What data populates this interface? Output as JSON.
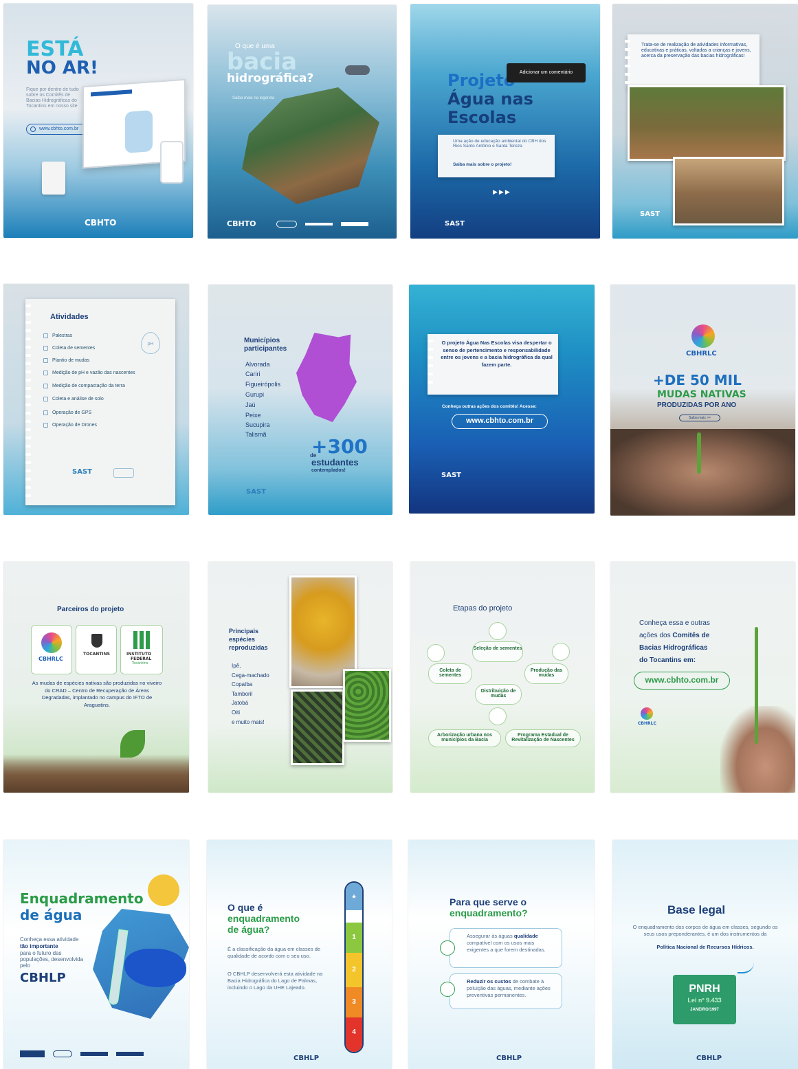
{
  "cards": {
    "c1": {
      "title1": "ESTÁ",
      "title2": "NO AR!",
      "body": "Fique por dentro de tudo sobre os Comitês de Bacias Hidrográficas do Tocantins em nosso site",
      "url": "www.cbhto.com.br",
      "logo": "CBHTO"
    },
    "c2": {
      "q1": "O que é uma",
      "q2": "bacia",
      "q3": "hidrográfica?",
      "sub": "Saiba mais na legenda",
      "logo": "CBHTO"
    },
    "c3": {
      "t1": "Projeto",
      "t2": "Água nas",
      "t3": "Escolas",
      "tooltip": "Adicionar um comentário",
      "b1": "Uma ação de educação ambiental do CBH dos Rios Santo Antônio e Santa Tereza",
      "b2": "Saiba mais sobre o projeto!",
      "arrows": "▶▶▶",
      "logo": "SAST"
    },
    "c4": {
      "note": "Trata-se de realização de atividades informativas, educativas e práticas, voltadas a crianças e jovens, acerca da preservação das bacias hidrográficas!",
      "logo": "SAST"
    },
    "c5": {
      "title": "Atividades",
      "items": [
        "Palestras",
        "Coleta de sementes",
        "Plantio de mudas",
        "Medição de pH e vazão das nascentes",
        "Medição de compactação da terra",
        "Coleta e análise de solo",
        "Operação de GPS",
        "Operação de Drones"
      ],
      "ph": "pH",
      "logo": "SAST"
    },
    "c6": {
      "title1": "Municípios",
      "title2": "participantes",
      "items": [
        "Alvorada",
        "Cariri",
        "Figueirópolis",
        "Gurupi",
        "Jaú",
        "Peixe",
        "Sucupira",
        "Talismã"
      ],
      "de": "de",
      "big": "+300",
      "label1": "estudantes",
      "label2": "contemplados!",
      "logo": "SAST"
    },
    "c7": {
      "text": "O projeto Água Nas Escolas visa despertar o senso de pertencimento e responsabilidade entre os jovens e a bacia hidrográfica da qual fazem parte.",
      "cta": "Conheça outras ações dos comitês! Acesse:",
      "url": "www.cbhto.com.br",
      "logo": "SAST"
    },
    "c8": {
      "logo": "CBHRLC",
      "l1": "+DE 50 MIL",
      "l2": "MUDAS NATIVAS",
      "l3": "PRODUZIDAS POR ANO",
      "more": "Saiba mais >>"
    },
    "c9": {
      "title": "Parceiros do projeto",
      "p1": "CBHRLC",
      "p2": "TOCANTINS",
      "p3a": "INSTITUTO",
      "p3b": "FEDERAL",
      "p3c": "Tocantins",
      "body": "As mudas de espécies nativas são produzidas no viveiro do CRAD – Centro de Recuperação de Áreas Degradadas, implantado no campus do IFTO de Araguatins."
    },
    "c10": {
      "t1": "Principais",
      "t2": "espécies",
      "t3": "reproduzidas",
      "items": [
        "Ipê,",
        "Cega-machado",
        "Copaíba",
        "Tamboril",
        "Jatobá",
        "Oiti",
        "e muito mais!"
      ]
    },
    "c11": {
      "title": "Etapas do projeto",
      "s1": "Seleção de sementes",
      "s2": "Produção das mudas",
      "s3": "Coleta de sementes",
      "s4": "Distribuição de mudas",
      "s5": "Arborização urbana nos municípios da Bacia",
      "s6": "Programa Estadual de Revitalização de Nascentes"
    },
    "c12": {
      "l1": "Conheça essa e outras",
      "l2": "ações dos",
      "l2b": "Comitês de",
      "l3": "Bacias Hidrográficas",
      "l4": "do Tocantins em:",
      "url": "www.cbhto.com.br",
      "logo": "CBHRLC"
    },
    "c13": {
      "t1": "Enquadramento",
      "t2": "de água",
      "body1": "Conheça essa atividade",
      "body2": "tão importante",
      "body3": "para o futuro das populações, desenvolvida pelo",
      "logo": "CBHLP"
    },
    "c14": {
      "q1": "O que é",
      "q2": "enquadramento",
      "q3": "de água?",
      "body1": "É a classificação da água em classes de qualidade de acordo com o seu uso.",
      "body2": "O CBHLP desenvolverá esta atividade na Bacia Hidrográfica do Lago de Palmas, incluindo o Lago da UHE Lajeado.",
      "classes": [
        "★",
        "1",
        "2",
        "3",
        "4"
      ],
      "logo": "CBHLP"
    },
    "c15": {
      "t1": "Para que serve o",
      "t2": "enquadramento?",
      "b1a": "Assegurar às águas",
      "b1b": "qualidade",
      "b1c": "compatível com os usos mais exigentes a que forem destinadas.",
      "b2a": "Reduzir os custos",
      "b2b": "de combate à poluição das águas, mediante ações preventivas permanentes.",
      "logo": "CBHLP"
    },
    "c16": {
      "title": "Base legal",
      "body1": "O enquadramento dos corpos de água em classes, segundo os seus usos preponderantes, é um dos instrumentos da",
      "body2": "Política Nacional de Recursos Hídricos.",
      "doc1": "PNRH",
      "doc2": "Lei nº 9.433",
      "doc3": "JANEIRO/1997",
      "logo": "CBHLP"
    }
  },
  "colors": {
    "navy": "#1d3f78",
    "teal": "#20a6c9",
    "green": "#2e9b4a",
    "purple": "#b04fd4",
    "blue": "#1b5fb8"
  }
}
